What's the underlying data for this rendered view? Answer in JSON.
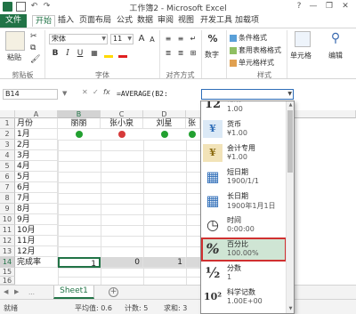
{
  "titlebar": {
    "title": "工作簿2 - Microsoft Excel",
    "minimize": "—",
    "restore": "❐",
    "close": "✕",
    "help": "?"
  },
  "tabs": [
    {
      "label": "文件"
    },
    {
      "label": "开始"
    },
    {
      "label": "插入"
    },
    {
      "label": "页面布局"
    },
    {
      "label": "公式"
    },
    {
      "label": "数据"
    },
    {
      "label": "审阅"
    },
    {
      "label": "视图"
    },
    {
      "label": "开发工具"
    },
    {
      "label": "加载项"
    }
  ],
  "ribbon": {
    "clipboard_label": "剪贴板",
    "paste_label": "粘贴",
    "font_name": "宋体",
    "font_size": "11",
    "bold": "B",
    "italic": "I",
    "underline": "U",
    "grow_font": "A",
    "shrink_font": "A",
    "font_group_label": "字体",
    "align_label": "对齐方式",
    "number_label": "数字",
    "percent": "%",
    "cond_format": "条件格式",
    "table_format": "套用表格格式",
    "cell_style": "单元格样式",
    "styles_label": "样式",
    "cells_label": "单元格",
    "edit_label": "编辑"
  },
  "formula_bar": {
    "name_box": "B14",
    "fx": "fx",
    "formula": "=AVERAGE(B2:"
  },
  "grid": {
    "columns": [
      "A",
      "B",
      "C",
      "D",
      "E"
    ],
    "headers_row": [
      "月份",
      "丽丽",
      "张小泉",
      "刘星",
      "张"
    ],
    "months": [
      "1月",
      "2月",
      "3月",
      "4月",
      "5月",
      "6月",
      "7月",
      "8月",
      "9月",
      "10月",
      "11月",
      "12月"
    ],
    "last_label": "完成率",
    "last_values": [
      "1",
      "0",
      "1"
    ],
    "row_numbers": [
      "1",
      "2",
      "3",
      "4",
      "5",
      "6",
      "7",
      "8",
      "9",
      "10",
      "11",
      "12",
      "13",
      "14",
      "15",
      "16"
    ],
    "dot_colors": {
      "green": "#22a030",
      "red": "#d63a3a"
    }
  },
  "sheet": {
    "tab_name": "Sheet1",
    "add": "+"
  },
  "status": {
    "ready": "就绪",
    "average": "平均值: 0.6",
    "count": "计数: 5",
    "sum": "求和: 3"
  },
  "number_formats": [
    {
      "icon": "12",
      "name": "常规",
      "sample": "1.00"
    },
    {
      "icon": "¥",
      "name": "货币",
      "sample": "¥1.00"
    },
    {
      "icon": "¥",
      "name": "会计专用",
      "sample": "¥1.00"
    },
    {
      "icon": "▦",
      "name": "短日期",
      "sample": "1900/1/1"
    },
    {
      "icon": "▦",
      "name": "长日期",
      "sample": "1900年1月1日"
    },
    {
      "icon": "◷",
      "name": "时间",
      "sample": "0:00:00"
    },
    {
      "icon": "%",
      "name": "百分比",
      "sample": "100.00%"
    },
    {
      "icon": "½",
      "name": "分数",
      "sample": "1"
    },
    {
      "icon": "10²",
      "name": "科学记数",
      "sample": "1.00E+00"
    }
  ],
  "accent_color": "#217346",
  "highlight_border": "#d03030"
}
